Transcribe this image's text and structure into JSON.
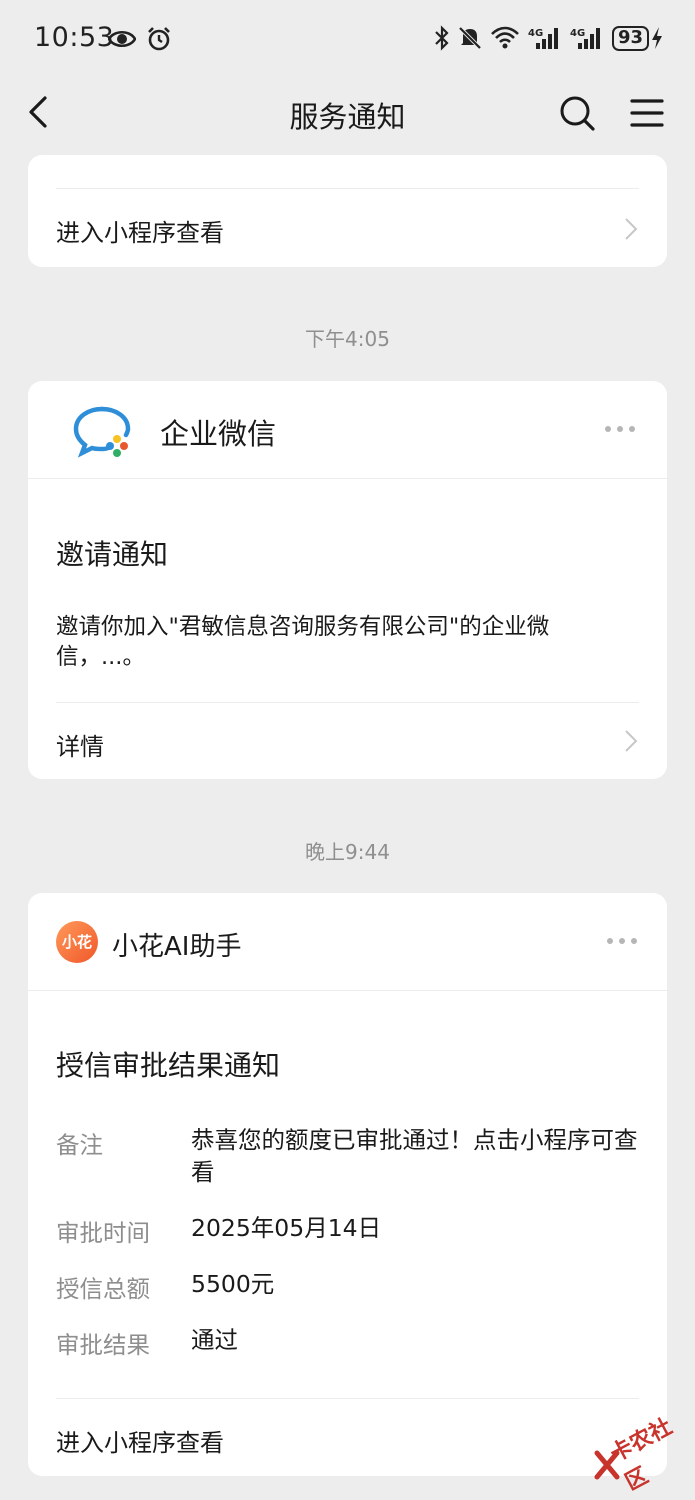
{
  "status": {
    "time": "10:53",
    "battery": "93"
  },
  "nav": {
    "title": "服务通知"
  },
  "cards": [
    {
      "link": "进入小程序查看"
    },
    {
      "sender": "企业微信",
      "title": "邀请通知",
      "body": "邀请你加入\"君敏信息咨询服务有限公司\"的企业微信，...。",
      "link": "详情"
    },
    {
      "sender": "小花AI助手",
      "avatar_text": "小花",
      "title": "授信审批结果通知",
      "fields": [
        {
          "label": "备注",
          "value": "恭喜您的额度已审批通过！点击小程序可查看"
        },
        {
          "label": "审批时间",
          "value": "2025年05月14日"
        },
        {
          "label": "授信总额",
          "value": "5500元"
        },
        {
          "label": "审批结果",
          "value": "通过"
        }
      ],
      "link": "进入小程序查看"
    }
  ],
  "timestamps": [
    "下午4:05",
    "晚上9:44"
  ],
  "watermark": "卡农社区"
}
